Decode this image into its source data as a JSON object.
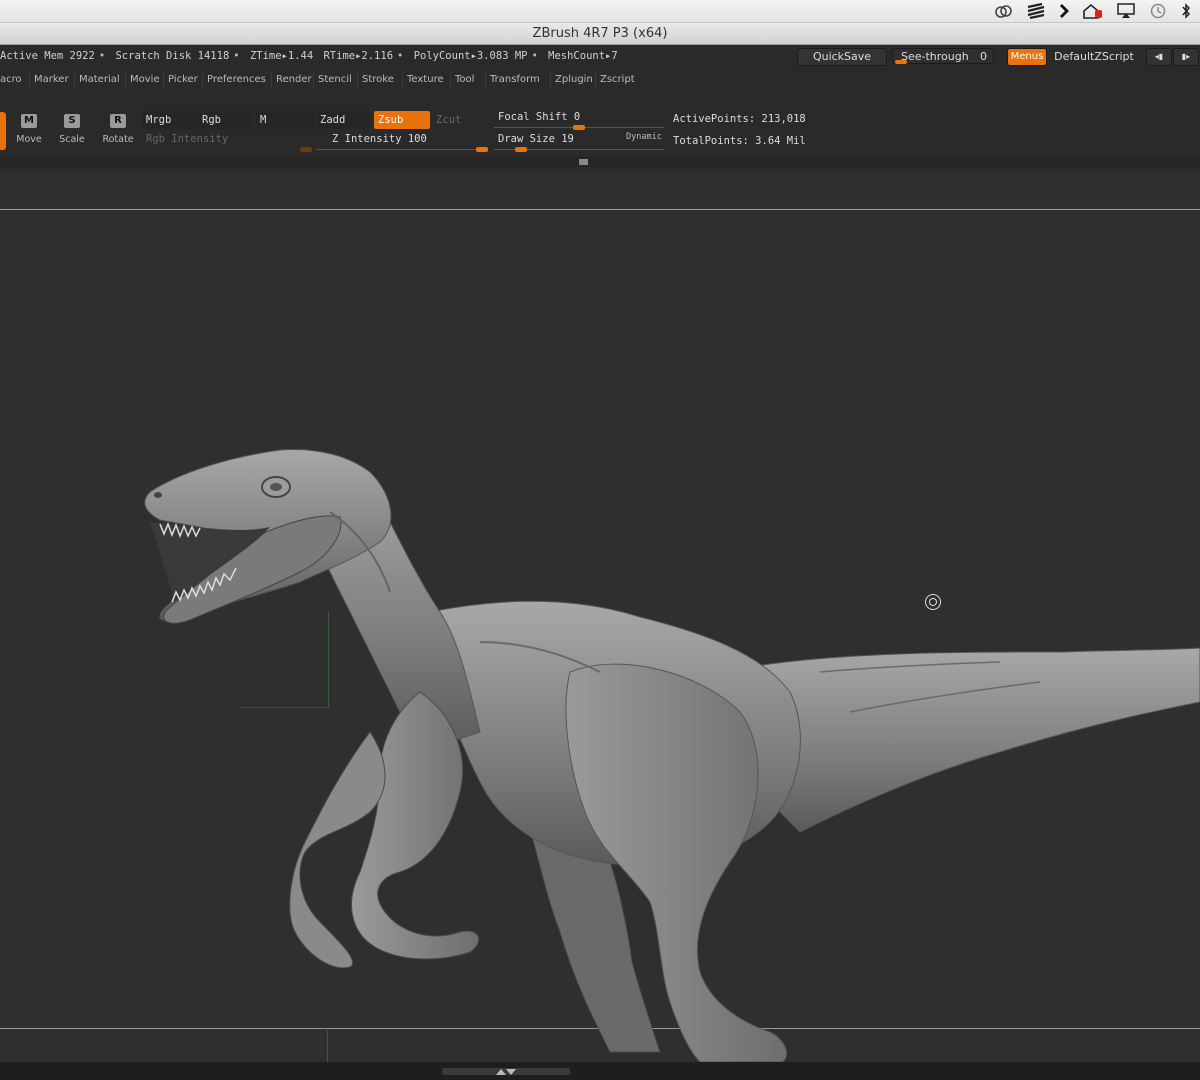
{
  "window": {
    "title": "ZBrush 4R7 P3 (x64)"
  },
  "tray_icons": [
    "creative-cloud-icon",
    "stack-icon",
    "chevron-icon",
    "home-icon",
    "airplay-icon",
    "time-machine-icon",
    "bluetooth-icon"
  ],
  "status": {
    "active_mem": "Active Mem 2922",
    "scratch_disk": "Scratch Disk 14118",
    "ztime": "ZTime▸1.44",
    "rtime": "RTime▸2.116",
    "polycount": "PolyCount▸3.083 MP",
    "meshcount": "MeshCount▸7"
  },
  "top_right": {
    "quicksave": "QuickSave",
    "see_through": "See-through",
    "see_through_value": "0",
    "menus": "Menus",
    "script": "DefaultZScript"
  },
  "menu": [
    "acro",
    "Marker",
    "Material",
    "Movie",
    "Picker",
    "Preferences",
    "Render",
    "Stencil",
    "Stroke",
    "Texture",
    "Tool",
    "Transform",
    "Zplugin",
    "Zscript"
  ],
  "tools": {
    "move": {
      "letter": "M",
      "label": "Move"
    },
    "scale": {
      "letter": "S",
      "label": "Scale"
    },
    "rotate": {
      "letter": "R",
      "label": "Rotate"
    }
  },
  "modes": {
    "mrgb": "Mrgb",
    "rgb": "Rgb",
    "m": "M",
    "rgb_intensity": "Rgb Intensity",
    "zadd": "Zadd",
    "zsub": "Zsub",
    "zcut": "Zcut",
    "z_intensity": "Z Intensity 100"
  },
  "brush": {
    "focal_shift": "Focal Shift 0",
    "draw_size": "Draw Size 19",
    "dynamic": "Dynamic"
  },
  "points": {
    "active": "ActivePoints: 213,018",
    "total": "TotalPoints: 3.64 Mil"
  },
  "colors": {
    "accent": "#e8720c",
    "panel": "#2a2a2a",
    "canvas": "#2f2f2f"
  }
}
